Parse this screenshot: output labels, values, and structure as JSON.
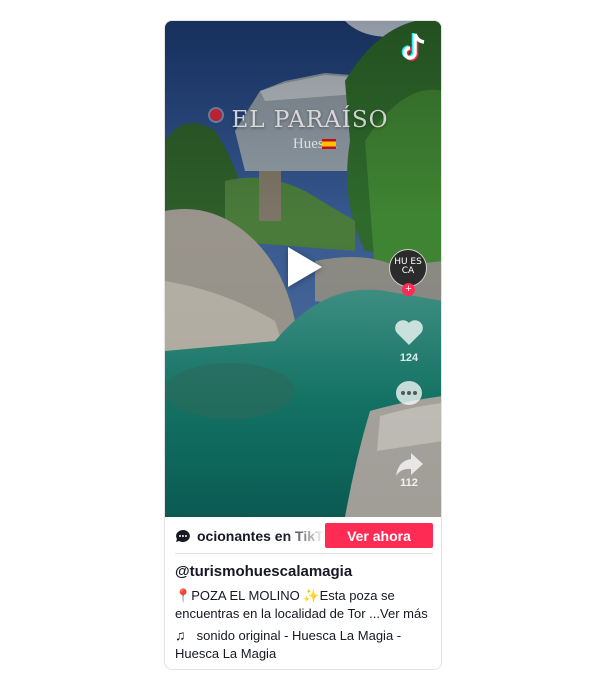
{
  "video": {
    "overlay_title": "EL PARAÍSO",
    "overlay_subtitle": "Huesca",
    "avatar_text": "HU ES CA",
    "likes_count": "124",
    "shares_count": "112"
  },
  "banner": {
    "text": "ocionantes en TikTok",
    "button_label": "Ver ahora"
  },
  "post": {
    "username": "@turismohuescalamagia",
    "pin_emoji": "📍",
    "title": "POZA EL MOLINO",
    "sparkle_emoji": "✨",
    "description": "Esta poza se encuentras en la localidad de Tor ...Ver más",
    "music_note": "♫",
    "music": "sonido original - Huesca La Magia - Huesca La Magia"
  },
  "colors": {
    "accent": "#fe2c55",
    "text": "#161823"
  }
}
